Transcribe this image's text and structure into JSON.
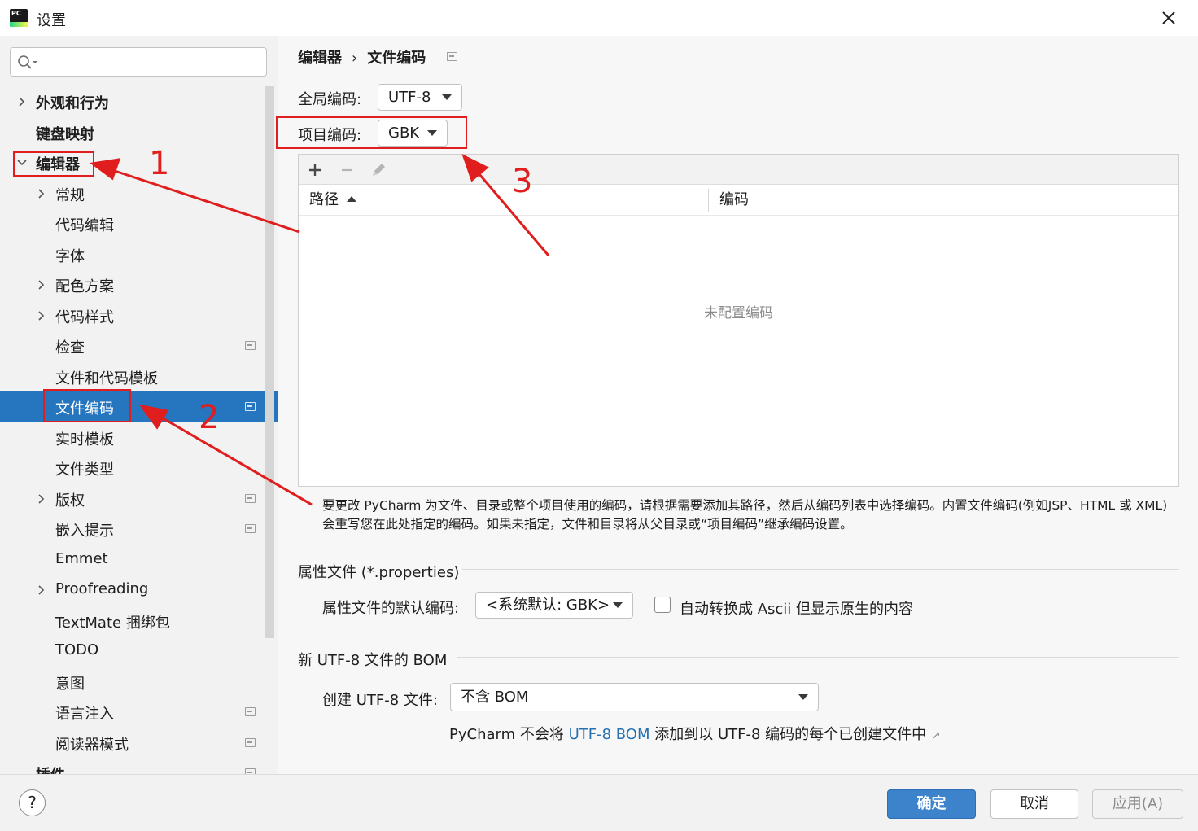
{
  "window": {
    "title": "设置",
    "app_icon_text": "PC"
  },
  "sidebar": {
    "search_placeholder": "",
    "items": [
      {
        "label": "外观和行为",
        "level": 0,
        "expandable": true,
        "expanded": false,
        "bold": true
      },
      {
        "label": "键盘映射",
        "level": 0,
        "expandable": false,
        "bold": true
      },
      {
        "label": "编辑器",
        "level": 0,
        "expandable": true,
        "expanded": true,
        "bold": true
      },
      {
        "label": "常规",
        "level": 1,
        "expandable": true
      },
      {
        "label": "代码编辑",
        "level": 1
      },
      {
        "label": "字体",
        "level": 1
      },
      {
        "label": "配色方案",
        "level": 1,
        "expandable": true
      },
      {
        "label": "代码样式",
        "level": 1,
        "expandable": true
      },
      {
        "label": "检查",
        "level": 1,
        "project_badge": true
      },
      {
        "label": "文件和代码模板",
        "level": 1
      },
      {
        "label": "文件编码",
        "level": 1,
        "selected": true,
        "project_badge": true
      },
      {
        "label": "实时模板",
        "level": 1
      },
      {
        "label": "文件类型",
        "level": 1
      },
      {
        "label": "版权",
        "level": 1,
        "expandable": true,
        "project_badge": true
      },
      {
        "label": "嵌入提示",
        "level": 1,
        "project_badge": true
      },
      {
        "label": "Emmet",
        "level": 1
      },
      {
        "label": "Proofreading",
        "level": 1,
        "expandable": true
      },
      {
        "label": "TextMate 捆绑包",
        "level": 1
      },
      {
        "label": "TODO",
        "level": 1
      },
      {
        "label": "意图",
        "level": 1
      },
      {
        "label": "语言注入",
        "level": 1,
        "project_badge": true
      },
      {
        "label": "阅读器模式",
        "level": 1,
        "project_badge": true
      },
      {
        "label": "插件",
        "level": 0,
        "bold": true,
        "project_badge": true
      }
    ]
  },
  "breadcrumb": {
    "parent": "编辑器",
    "separator": "›",
    "current": "文件编码"
  },
  "global_encoding": {
    "label": "全局编码:",
    "value": "UTF-8"
  },
  "project_encoding": {
    "label": "项目编码:",
    "value": "GBK"
  },
  "table": {
    "columns": [
      "路径",
      "编码"
    ],
    "empty_text": "未配置编码",
    "toolbar": [
      "add-icon",
      "remove-icon",
      "edit-icon"
    ]
  },
  "help_text": "要更改 PyCharm 为文件、目录或整个项目使用的编码，请根据需要添加其路径，然后从编码列表中选择编码。内置文件编码(例如JSP、HTML 或 XML)会重写您在此处指定的编码。如果未指定，文件和目录将从父目录或“项目编码”继承编码设置。",
  "properties_section": {
    "title": "属性文件 (*.properties)",
    "default_label": "属性文件的默认编码:",
    "default_value": "<系统默认: GBK>",
    "ascii_checkbox_label": "自动转换成 Ascii 但显示原生的内容",
    "ascii_checked": false
  },
  "bom_section": {
    "title": "新 UTF-8 文件的 BOM",
    "create_label": "创建 UTF-8 文件:",
    "create_value": "不含 BOM",
    "note_prefix": "PyCharm 不会将 ",
    "note_link": "UTF-8 BOM",
    "note_suffix": " 添加到以 UTF-8 编码的每个已创建文件中",
    "note_arrow": "↗"
  },
  "footer": {
    "help": "?",
    "ok": "确定",
    "cancel": "取消",
    "apply": "应用(A)"
  },
  "annotations": {
    "numbers": [
      "1",
      "2",
      "3"
    ],
    "color": "#e01e1e"
  },
  "colors": {
    "selection": "#2675bf",
    "primary_button": "#3c83cc",
    "link": "#2470b3"
  }
}
